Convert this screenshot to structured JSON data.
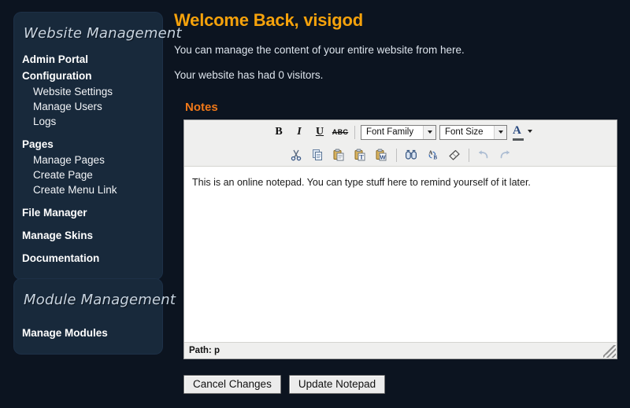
{
  "sidebar": {
    "panels": [
      {
        "title": "Website Management",
        "items": [
          {
            "label": "Admin Portal",
            "level": 0,
            "gap": false
          },
          {
            "label": "Configuration",
            "level": 0,
            "gap": false
          },
          {
            "label": "Website Settings",
            "level": 1,
            "gap": false
          },
          {
            "label": "Manage Users",
            "level": 1,
            "gap": false
          },
          {
            "label": "Logs",
            "level": 1,
            "gap": false
          },
          {
            "label": "Pages",
            "level": 0,
            "gap": true
          },
          {
            "label": "Manage Pages",
            "level": 1,
            "gap": false
          },
          {
            "label": "Create Page",
            "level": 1,
            "gap": false
          },
          {
            "label": "Create Menu Link",
            "level": 1,
            "gap": false
          },
          {
            "label": "File Manager",
            "level": 0,
            "gap": true
          },
          {
            "label": "Manage Skins",
            "level": 0,
            "gap": false
          },
          {
            "label": "Documentation",
            "level": 0,
            "gap": false
          }
        ]
      },
      {
        "title": "Module Management",
        "items": [
          {
            "label": "Manage Modules",
            "level": 0,
            "gap": true
          }
        ]
      }
    ]
  },
  "main": {
    "page_title": "Welcome Back, visigod",
    "intro_line_1": "You can manage the content of your entire website from here.",
    "intro_line_2": "Your website has had 0 visitors.",
    "notes_heading": "Notes"
  },
  "editor": {
    "toolbar_row1": {
      "bold": "B",
      "italic": "I",
      "underline": "U",
      "strikethrough": "ABC",
      "font_family_value": "Font Family",
      "font_size_value": "Font Size",
      "forecolor_label": "A"
    },
    "toolbar_row2": {
      "cut": "Cut",
      "copy": "Copy",
      "paste": "Paste",
      "paste_as_text": "Paste as Plain Text",
      "paste_from_word": "Paste from Word",
      "find": "Find",
      "find_replace": "Find/Replace",
      "remove_formatting": "Remove formatting",
      "undo": "Undo",
      "redo": "Redo"
    },
    "content": "This is an online notepad. You can type stuff here to remind yourself of it later.",
    "status": "Path: p"
  },
  "form": {
    "cancel_label": "Cancel Changes",
    "submit_label": "Update Notepad"
  },
  "colors": {
    "page_background": "#0c1420",
    "panel_background": "#18293b",
    "title_accent": "#f6a20b",
    "notes_accent": "#f07818",
    "body_text": "#dde4ec",
    "toolbar_background": "#efefee"
  }
}
